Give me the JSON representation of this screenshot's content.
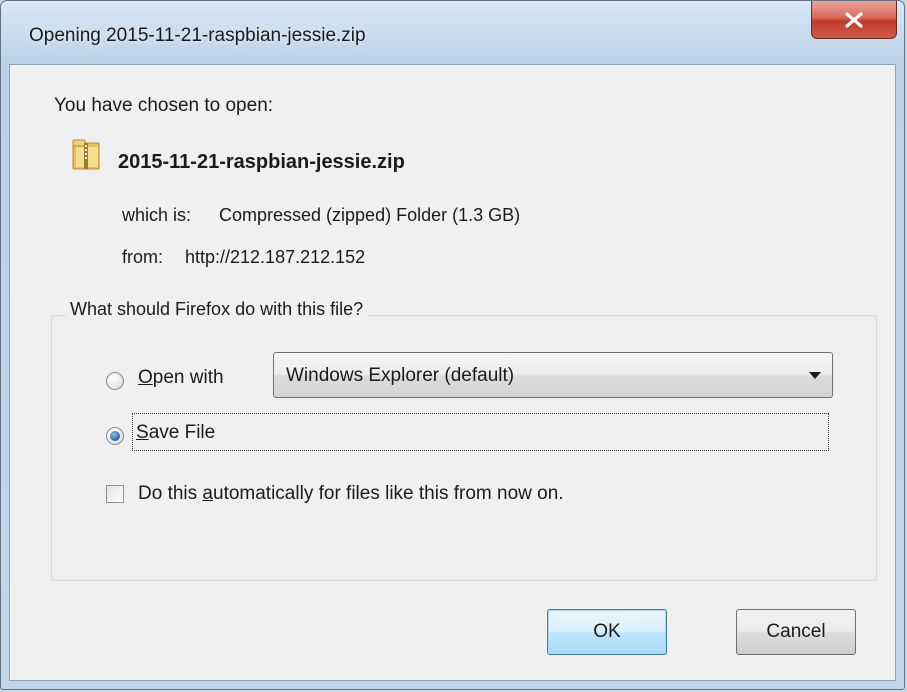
{
  "window": {
    "title": "Opening 2015-11-21-raspbian-jessie.zip",
    "close_icon": "close-icon"
  },
  "info": {
    "chosen_text": "You have chosen to open:",
    "file_icon": "zip-folder-icon",
    "filename": "2015-11-21-raspbian-jessie.zip",
    "which_label": "which is:",
    "which_value": "Compressed (zipped) Folder (1.3 GB)",
    "from_label": "from:",
    "from_value": "http://212.187.212.152"
  },
  "action": {
    "group_title": "What should Firefox do with this file?",
    "open_with": {
      "mnemonic": "O",
      "label_rest": "pen with",
      "selected": false,
      "app_select_value": "Windows Explorer (default)"
    },
    "save_file": {
      "mnemonic": "S",
      "label_rest": "ave File",
      "selected": true
    },
    "auto": {
      "label_before": "Do this ",
      "mnemonic": "a",
      "label_after": "utomatically for files like this from now on.",
      "checked": false
    }
  },
  "buttons": {
    "ok": "OK",
    "cancel": "Cancel"
  },
  "colors": {
    "close_button": "#c0392b",
    "ok_button_border": "#3c7fb1",
    "dialog_background": "#f0f0f0"
  }
}
